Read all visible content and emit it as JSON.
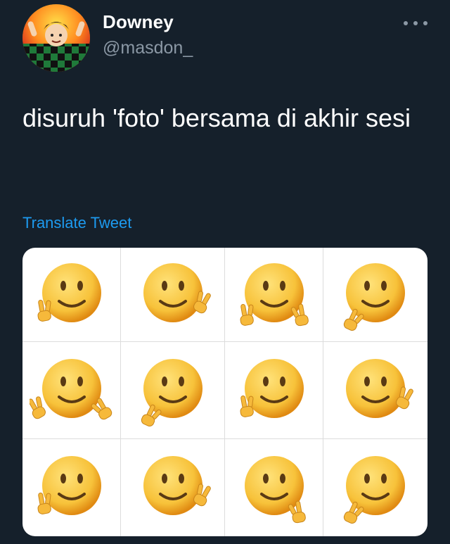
{
  "user": {
    "display_name": "Downey",
    "handle": "@masdon_"
  },
  "tweet": {
    "text": "disuruh 'foto' bersama di akhir sesi",
    "translate_label": "Translate Tweet"
  },
  "media": {
    "type": "emoji-grid",
    "rows": 3,
    "columns": 4,
    "cells": [
      {
        "emoji": "slightly-smiling-face",
        "hands": "peace-left"
      },
      {
        "emoji": "slightly-smiling-face",
        "hands": "peace-right"
      },
      {
        "emoji": "slightly-smiling-face",
        "hands": "peace-both-low"
      },
      {
        "emoji": "slightly-smiling-face",
        "hands": "peace-left-low"
      },
      {
        "emoji": "slightly-smiling-face",
        "hands": "peace-both-wide"
      },
      {
        "emoji": "slightly-smiling-face",
        "hands": "peace-left-low"
      },
      {
        "emoji": "slightly-smiling-face",
        "hands": "peace-left"
      },
      {
        "emoji": "slightly-smiling-face",
        "hands": "peace-right"
      },
      {
        "emoji": "slightly-smiling-face",
        "hands": "peace-left"
      },
      {
        "emoji": "slightly-smiling-face",
        "hands": "peace-right"
      },
      {
        "emoji": "slightly-smiling-face",
        "hands": "peace-right-low"
      },
      {
        "emoji": "slightly-smiling-face",
        "hands": "peace-left-low"
      }
    ]
  },
  "colors": {
    "background": "#15202b",
    "text_primary": "#ffffff",
    "text_secondary": "#8b98a5",
    "link": "#1d9bf0",
    "emoji_face": "#f7c23a"
  }
}
